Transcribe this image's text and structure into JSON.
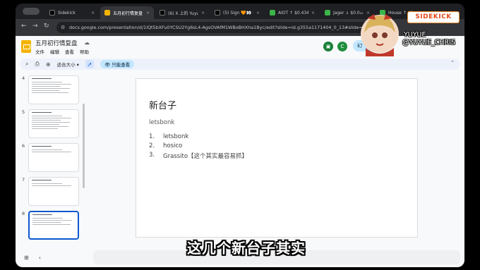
{
  "browser": {
    "tabs": [
      {
        "label": "Sidekick",
        "fav": "x"
      },
      {
        "label": "五月初行情复盘",
        "fav": "slides"
      },
      {
        "label": "(6) X 上的 Yuyue",
        "fav": "x"
      },
      {
        "label": "(5) Sign 🧡👀 (",
        "fav": "x"
      },
      {
        "label": "AIOT ↑ $0.4346",
        "fav": "green"
      },
      {
        "label": "Jager ↓ $0.0₁₀",
        "fav": "green"
      },
      {
        "label": "House ↑ $0...",
        "fav": "green"
      }
    ],
    "url": "docs.google.com/presentation/d/1lQt5bXFu0YCSU2Yg6sL4-AgsOVAfM1WBoBHXha1Byc/edit?slide=id.g355a1171404_0_13#slide=id.g..."
  },
  "app": {
    "title": "五月初行情复盘",
    "menu": [
      "文件",
      "编辑",
      "查看",
      "帮助"
    ],
    "user_initial": "C",
    "share_label": "幻",
    "zoom_label": "适合大小",
    "view_only_label": "只能查看"
  },
  "filmstrip": [
    {
      "num": "4",
      "selected": false,
      "lines": 7
    },
    {
      "num": "5",
      "selected": false,
      "lines": 8
    },
    {
      "num": "6",
      "selected": false,
      "lines": 3
    },
    {
      "num": "7",
      "selected": false,
      "lines": 3
    },
    {
      "num": "8",
      "selected": true,
      "lines": 5
    }
  ],
  "slide": {
    "title": "新台子",
    "subtitle": "letsbonk",
    "items": [
      {
        "num": "1.",
        "text": "letsbonk"
      },
      {
        "num": "2.",
        "text": "hosico"
      },
      {
        "num": "3.",
        "text": "Grassito【这个其实最容易抓】"
      }
    ]
  },
  "overlay": {
    "subtitle": "这几个新台子其实",
    "sidekick": "SIDEKICK",
    "handle_line1": "YUYUE",
    "handle_line2": "@YUYUE_CHRIS"
  },
  "colors": {
    "accent": "#0b57d0",
    "slides_yellow": "#f4b400",
    "sidekick_orange": "#e24a1b"
  }
}
